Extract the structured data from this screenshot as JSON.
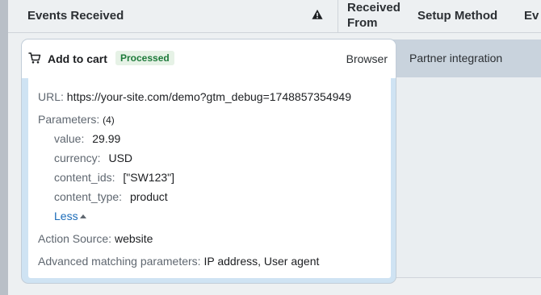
{
  "table": {
    "headers": {
      "events_received": "Events Received",
      "received_from": "Received From",
      "setup_method": "Setup Method",
      "ev_truncated": "Ev"
    },
    "warning_icon": "warning-triangle-icon"
  },
  "event": {
    "icon": "shopping-cart-icon",
    "name": "Add to cart",
    "status": "Processed",
    "received_from": "Browser",
    "setup_method": "Partner integration",
    "url_label": "URL:",
    "url_value": "https://your-site.com/demo?gtm_debug=1748857354949",
    "parameters_label": "Parameters:",
    "parameters_count": "(4)",
    "parameters": [
      {
        "key": "value:",
        "value": "29.99"
      },
      {
        "key": "currency:",
        "value": "USD"
      },
      {
        "key": "content_ids:",
        "value": "[\"SW123\"]"
      },
      {
        "key": "content_type:",
        "value": "product"
      }
    ],
    "less_label": "Less",
    "action_source_label": "Action Source:",
    "action_source_value": "website",
    "advanced_matching_label": "Advanced matching parameters:",
    "advanced_matching_value": "IP address, User agent"
  },
  "colors": {
    "status_text": "#1d7a3a",
    "status_bg": "#e6f2e6",
    "link": "#1a6bb8",
    "card_highlight": "#cfe3f3"
  }
}
